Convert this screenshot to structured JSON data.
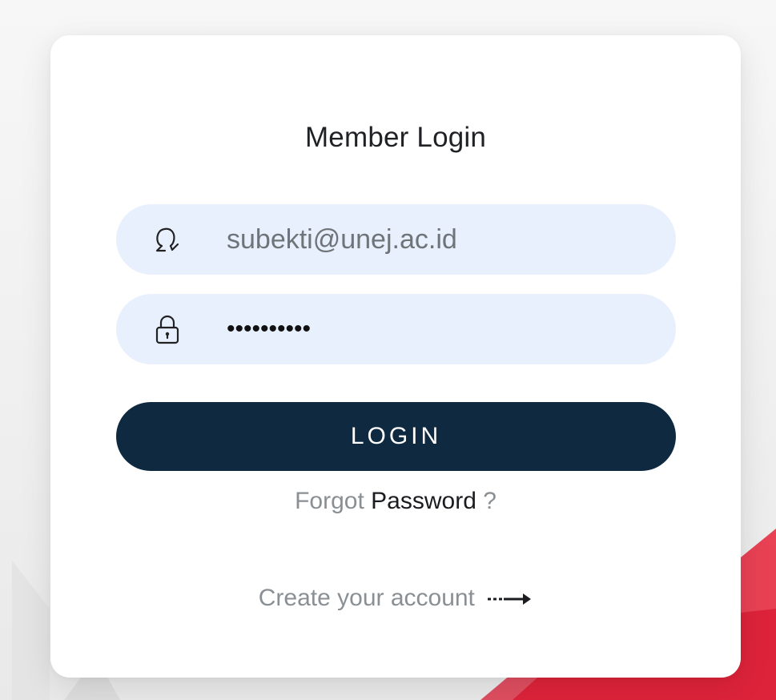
{
  "login_card": {
    "title": "Member Login",
    "email": {
      "value": "subekti@unej.ac.id",
      "icon": "user-icon"
    },
    "password": {
      "value": "••••••••••",
      "icon": "lock-icon"
    },
    "login_button": "LOGIN",
    "forgot": {
      "prefix": "Forgot",
      "link": "Password",
      "suffix": "?"
    },
    "create_account": {
      "label": "Create your account",
      "icon": "arrow-right-icon"
    }
  },
  "colors": {
    "button": "#0f2940",
    "input_bg": "#e8f0fe",
    "accent_red": "#e8233a"
  }
}
